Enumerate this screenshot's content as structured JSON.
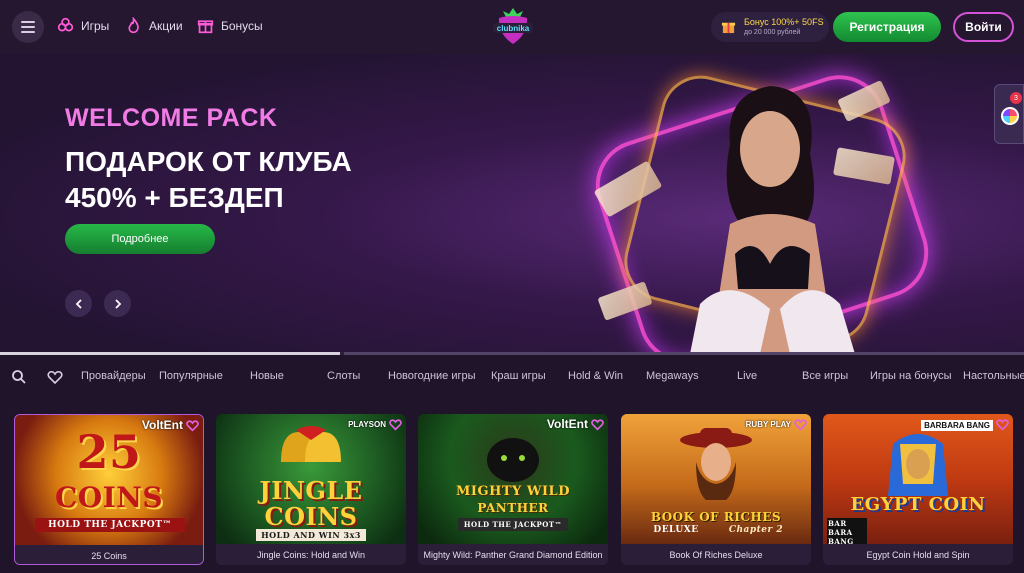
{
  "header": {
    "nav": [
      {
        "label": "Игры",
        "icon": "strawberry-icon"
      },
      {
        "label": "Акции",
        "icon": "flame-icon"
      },
      {
        "label": "Бонусы",
        "icon": "gift-icon"
      }
    ],
    "logo_alt": "clubnika",
    "bonus_line1": "Бонус 100%+ 50FS",
    "bonus_line2": "до 20 000 рублей",
    "register_label": "Регистрация",
    "login_label": "Войти"
  },
  "hero": {
    "welcome": "WELCOME PACK",
    "title_line1": "ПОДАРОК ОТ КЛУБА",
    "title_line2": "450% + БЕЗДЕП",
    "cta_label": "Подробнее",
    "slides_progress": 0.33
  },
  "side_widget": {
    "badge": "3"
  },
  "categories": [
    "Провайдеры",
    "Популярные",
    "Новые",
    "Слоты",
    "Новогодние игры",
    "Краш игры",
    "Hold & Win",
    "Megaways",
    "Live",
    "Все игры",
    "Игры на бонусы",
    "Настольные"
  ],
  "games": [
    {
      "name": "25 Coins",
      "provider": "VoltEnt",
      "art_title": "25",
      "art_sub": "COINS",
      "art_tag": "HOLD THE JACKPOT™"
    },
    {
      "name": "Jingle Coins: Hold and Win",
      "provider": "PLAYSON",
      "art_title": "JINGLE",
      "art_sub": "COINS",
      "art_tag": "HOLD AND WIN 3x3"
    },
    {
      "name": "Mighty Wild: Panther Grand Diamond Edition",
      "provider": "VoltEnt",
      "art_title": "MIGHTY WILD",
      "art_sub": "PANTHER",
      "art_tag": "HOLD THE JACKPOT™"
    },
    {
      "name": "Book Of Riches Deluxe",
      "provider": "RUBY PLAY",
      "art_title": "BOOK OF RICHES",
      "art_sub": "DELUXE",
      "art_tag": "Chapter 2"
    },
    {
      "name": "Egypt Coin Hold and Spin",
      "provider": "BARBARA BANG",
      "art_title": "EGYPT COIN",
      "art_sub": "",
      "art_tag": "BAR BARA BANG"
    }
  ],
  "colors": {
    "accent": "#d452d8",
    "green": "#1fa33f",
    "bg": "#1f1429"
  }
}
